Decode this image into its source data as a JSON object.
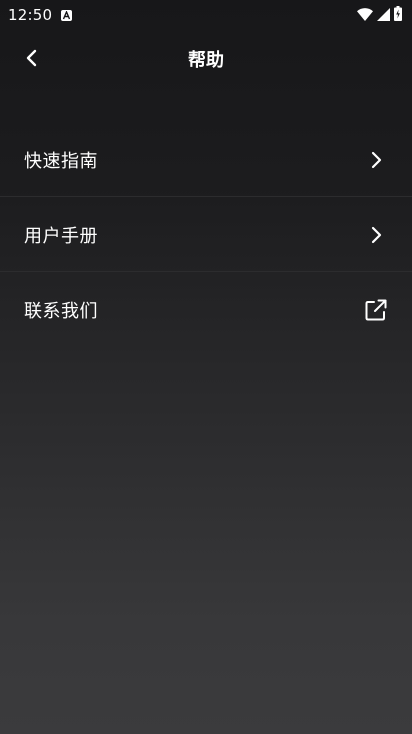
{
  "status_bar": {
    "time": "12:50",
    "icons": [
      "a-notification-icon",
      "wifi-icon",
      "cell-signal-icon",
      "battery-icon"
    ]
  },
  "app_bar": {
    "back_icon": "chevron-left-icon",
    "title": "帮助"
  },
  "menu": {
    "items": [
      {
        "label": "快速指南",
        "icon": "chevron-right-icon"
      },
      {
        "label": "用户手册",
        "icon": "chevron-right-icon"
      },
      {
        "label": "联系我们",
        "icon": "external-link-icon"
      }
    ]
  },
  "colors": {
    "background_top": "#171719",
    "background_bottom": "#3b3b3d",
    "text": "#ffffff",
    "divider": "#2c2c2e"
  }
}
